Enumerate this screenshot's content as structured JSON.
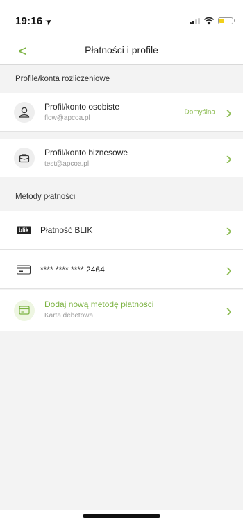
{
  "status_bar": {
    "time": "19:16"
  },
  "nav": {
    "back_label": "<",
    "title": "Płatności i profile"
  },
  "profiles_section": {
    "header": "Profile/konta rozliczeniowe",
    "items": [
      {
        "title": "Profil/konto osobiste",
        "email": "flow@apcoa.pl",
        "badge": "Domyślna",
        "icon": "person-icon"
      },
      {
        "title": "Profil/konto biznesowe",
        "email": "test@apcoa.pl",
        "icon": "briefcase-icon"
      }
    ]
  },
  "payment_section": {
    "header": "Metody płatności",
    "blik": {
      "logo": "blik",
      "label": "Płatność BLIK"
    },
    "card": {
      "label": "**** **** **** 2464"
    },
    "add": {
      "title": "Dodaj nową metodę płatności",
      "subtitle": "Karta debetowa"
    }
  },
  "chevron": "›",
  "colors": {
    "accent": "#7cb342",
    "background": "#f3f3f3"
  }
}
